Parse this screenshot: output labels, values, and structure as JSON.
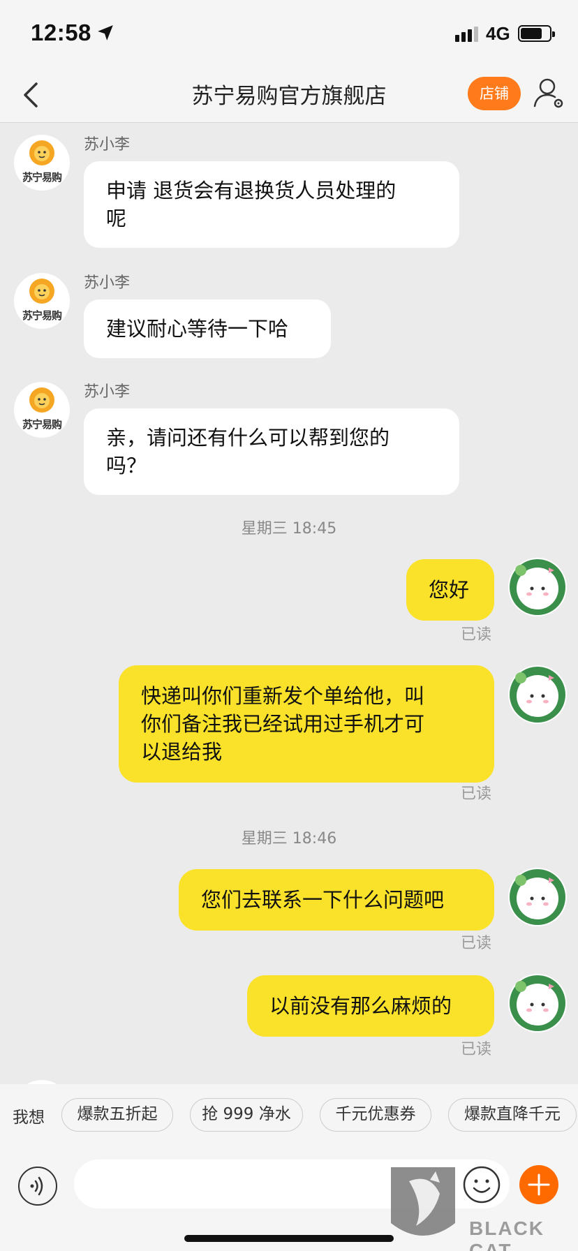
{
  "status_bar": {
    "time": "12:58",
    "network": "4G",
    "battery_level": 0.75
  },
  "header": {
    "title": "苏宁易购官方旗舰店",
    "store_button": "店铺"
  },
  "seller": {
    "name": "苏小李",
    "logo_text": "苏宁易购"
  },
  "messages": {
    "m1": "申请 退货会有退换货人员处理的呢",
    "m1_line1": "申请 退货会有退换货人员处理的",
    "m1_line2": "呢",
    "m2": "建议耐心等待一下哈",
    "m3_line1": "亲，请问还有什么可以帮到您的",
    "m3_line2": "吗？",
    "stamp1": "星期三 18:45",
    "u1": "您好",
    "u2_line1": "快递叫你们重新发个单给他，叫",
    "u2_line2": "你们备注我已经试用过手机才可",
    "u2_line3": "以退给我",
    "stamp2": "星期三 18:46",
    "u3": "您们去联系一下什么问题吧",
    "u4": "以前没有那么麻烦的",
    "read_label": "已读"
  },
  "quick_replies": {
    "lead": "我想",
    "items": [
      "爆款五折起",
      "抢 999 净水",
      "千元优惠券",
      "爆款直降千元"
    ]
  },
  "input": {
    "placeholder": ""
  },
  "watermark": {
    "text": "BLACK CAT",
    "glyph": "黑猫"
  },
  "colors": {
    "accent_orange": "#ff7a1a",
    "user_bubble": "#fae22a",
    "background": "#ebebeb"
  }
}
